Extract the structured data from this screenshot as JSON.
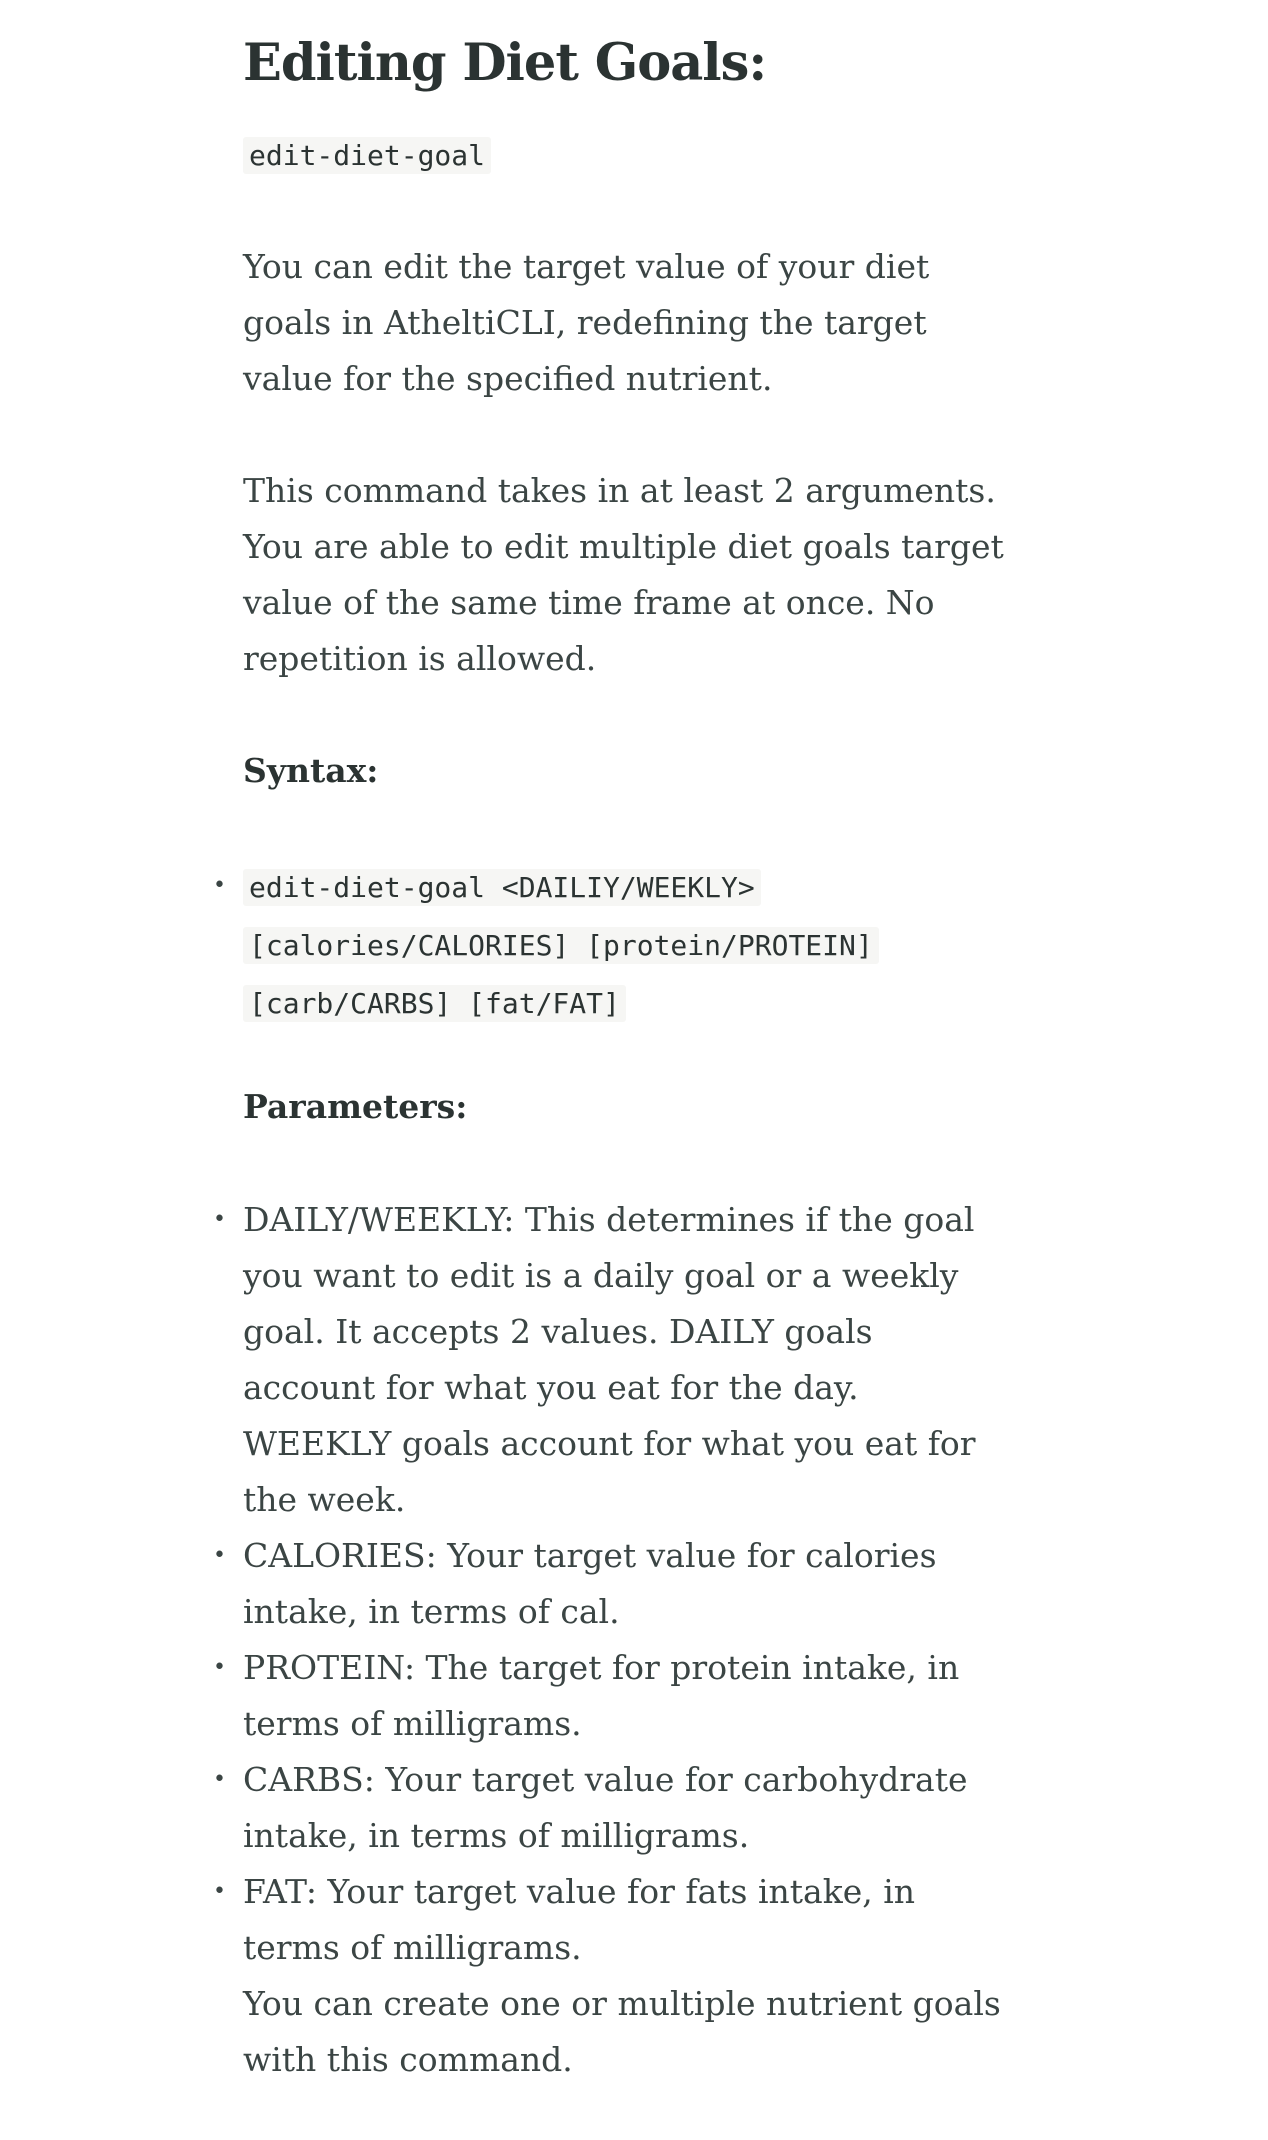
{
  "heading": "Editing Diet Goals:",
  "command": "edit-diet-goal",
  "paragraphs": {
    "intro": "You can edit the target value of your diet goals in AtheltiCLI, redefining the target value for the specified nutrient.",
    "arguments": "This command takes in at least 2 arguments. You are able to edit multiple diet goals target value of the same time frame at once. No repetition is allowed.",
    "closing": "You can create one or multiple nutrient goals with this command."
  },
  "syntax": {
    "label": "Syntax:",
    "items": [
      "edit-diet-goal <DAILIY/WEEKLY> [calories/CALORIES] [protein/PROTEIN] [carb/CARBS] [fat/FAT]"
    ]
  },
  "parameters": {
    "label": "Parameters:",
    "items": [
      "DAILY/WEEKLY: This determines if the goal you want to edit is a daily goal or a weekly goal. It accepts 2 values. DAILY goals account for what you eat for the day. WEEKLY goals account for what you eat for the week.",
      "CALORIES: Your target value for calories intake, in terms of cal.",
      "PROTEIN: The target for protein intake, in terms of milligrams.",
      "CARBS: Your target value for carbohydrate intake, in terms of milligrams.",
      "FAT: Your target value for fats intake, in terms of milligrams."
    ]
  },
  "bullet": "•"
}
